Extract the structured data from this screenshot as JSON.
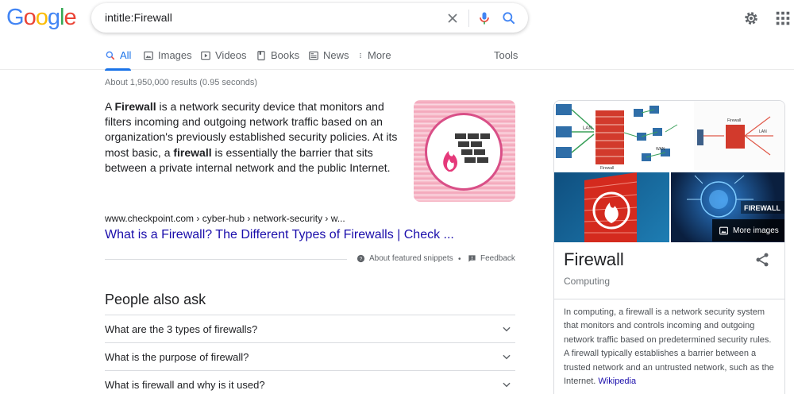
{
  "logo": {
    "letters": [
      "G",
      "o",
      "o",
      "g",
      "l",
      "e"
    ],
    "colors": [
      "#4285f4",
      "#ea4335",
      "#fbbc05",
      "#4285f4",
      "#34a853",
      "#ea4335"
    ]
  },
  "search": {
    "query": "intitle:Firewall"
  },
  "tabs": [
    {
      "label": "All",
      "icon": "search-icon"
    },
    {
      "label": "Images",
      "icon": "image-icon"
    },
    {
      "label": "Videos",
      "icon": "video-icon"
    },
    {
      "label": "Books",
      "icon": "book-icon"
    },
    {
      "label": "News",
      "icon": "news-icon"
    },
    {
      "label": "More",
      "icon": "more-vert-icon"
    }
  ],
  "tools_label": "Tools",
  "stats": "About 1,950,000 results (0.95 seconds)",
  "snippet": {
    "p1": "A ",
    "b1": "Firewall",
    "p2": " is a network security device that monitors and filters incoming and outgoing network traffic based on an organization's previously established security policies. At its most basic, a ",
    "b2": "firewall",
    "p3": " is essentially the barrier that sits between a private internal network and the public Internet.",
    "cite": "www.checkpoint.com › cyber-hub › network-security › w...",
    "link": "What is a Firewall? The Different Types of Firewalls | Check ...",
    "about": "About featured snippets",
    "dot": "•",
    "feedback": "Feedback"
  },
  "paa": {
    "title": "People also ask",
    "questions": [
      "What are the 3 types of firewalls?",
      "What is the purpose of firewall?",
      "What is firewall and why is it used?"
    ]
  },
  "knowledge_panel": {
    "title": "Firewall",
    "subtitle": "Computing",
    "description": "In computing, a firewall is a network security system that monitors and controls incoming and outgoing network traffic based on predetermined security rules. A firewall typically establishes a barrier between a trusted network and an untrusted network, such as the Internet. ",
    "source": "Wikipedia",
    "more_images": "More images",
    "img_label": "FIREWALL",
    "diag_lan": "LAN",
    "diag_wan": "WAN",
    "diag_firewall": "Firewall"
  },
  "colors": {
    "accent": "#1a73e8",
    "link": "#1a0dab"
  }
}
